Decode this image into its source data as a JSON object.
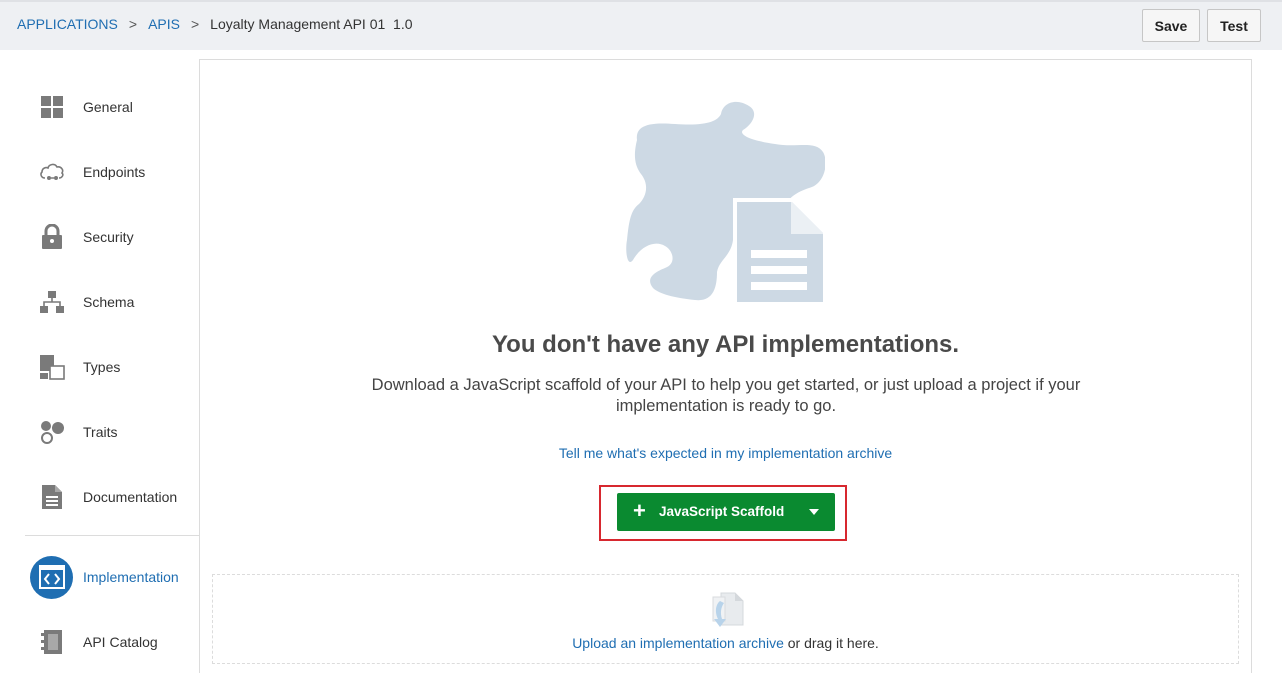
{
  "breadcrumb": {
    "items": [
      "APPLICATIONS",
      "APIS"
    ],
    "separator": ">",
    "current": "Loyalty Management API 01  1.0"
  },
  "toolbar": {
    "save_label": "Save",
    "test_label": "Test"
  },
  "sidebar": {
    "items": [
      {
        "label": "General",
        "icon": "grid-icon"
      },
      {
        "label": "Endpoints",
        "icon": "cloud-icon"
      },
      {
        "label": "Security",
        "icon": "lock-icon"
      },
      {
        "label": "Schema",
        "icon": "hierarchy-icon"
      },
      {
        "label": "Types",
        "icon": "types-icon"
      },
      {
        "label": "Traits",
        "icon": "traits-icon"
      },
      {
        "label": "Documentation",
        "icon": "document-icon"
      },
      {
        "label": "Implementation",
        "icon": "code-icon",
        "active": true
      },
      {
        "label": "API Catalog",
        "icon": "catalog-icon"
      }
    ]
  },
  "main": {
    "headline": "You don't have any API implementations.",
    "description": "Download a JavaScript scaffold of your API to help you get started, or just upload a project if your implementation is ready to go.",
    "help_link": "Tell me what's expected in my implementation archive",
    "scaffold_button": "JavaScript Scaffold",
    "upload_link": "Upload an implementation archive",
    "upload_suffix": " or drag it here."
  },
  "colors": {
    "accent": "#1f6eb2",
    "primary_button": "#0a8a30",
    "highlight_border": "#d7282f",
    "illustration": "#cdd9e4"
  }
}
